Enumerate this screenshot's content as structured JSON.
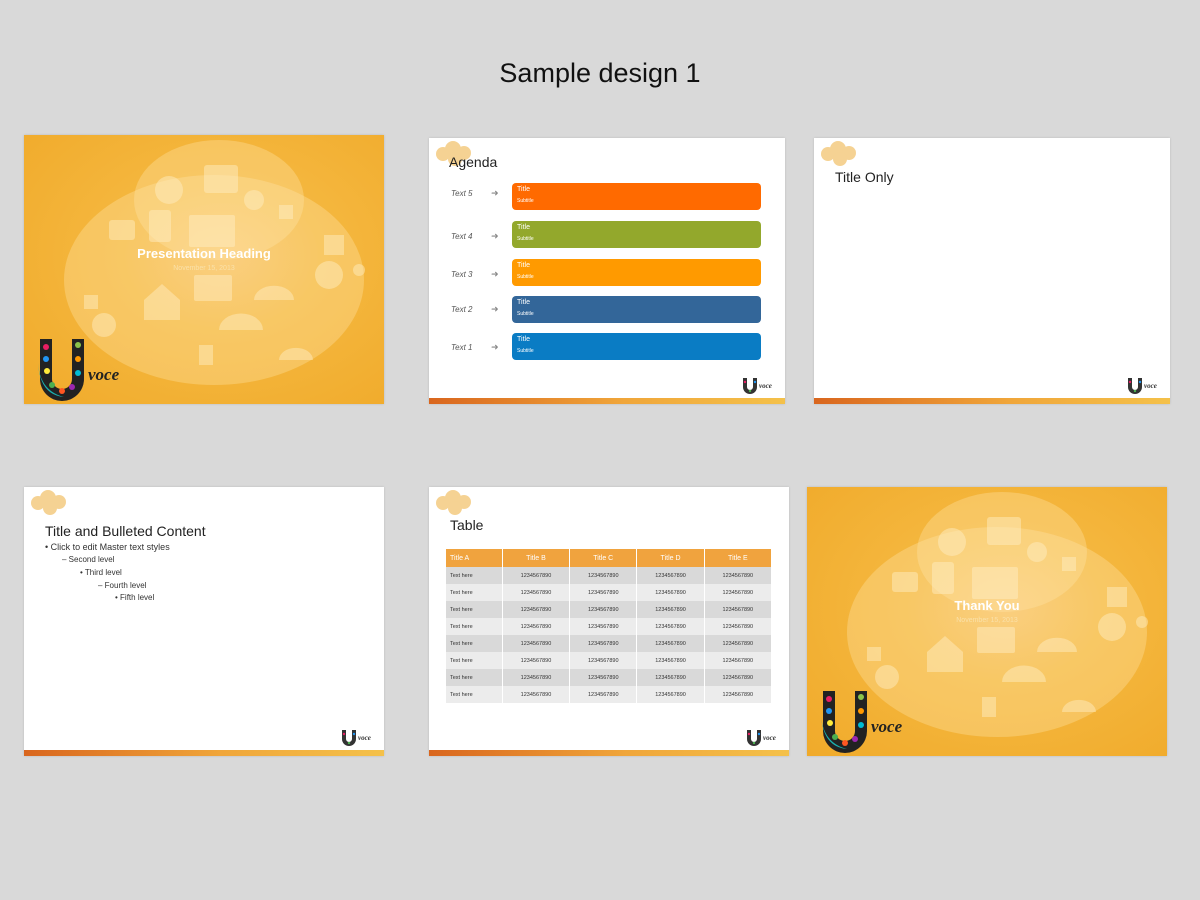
{
  "page_title": "Sample design 1",
  "slides": {
    "title_slide": {
      "heading": "Presentation Heading",
      "date": "November 15, 2013",
      "logo_text": "voce"
    },
    "agenda": {
      "title": "Agenda",
      "items": [
        {
          "label": "Text 5",
          "title": "Title",
          "subtitle": "Subtitle",
          "color": "#ff6a00"
        },
        {
          "label": "Text 4",
          "title": "Title",
          "subtitle": "Subtitle",
          "color": "#93a82c"
        },
        {
          "label": "Text 3",
          "title": "Title",
          "subtitle": "Subtitle",
          "color": "#ff9a00"
        },
        {
          "label": "Text 2",
          "title": "Title",
          "subtitle": "Subtitle",
          "color": "#336699"
        },
        {
          "label": "Text 1",
          "title": "Title",
          "subtitle": "Subtitle",
          "color": "#0a7cc4"
        }
      ]
    },
    "title_only": {
      "title": "Title Only"
    },
    "bulleted": {
      "title": "Title and Bulleted Content",
      "levels": [
        "Click to edit Master text styles",
        "Second level",
        "Third level",
        "Fourth level",
        "Fifth level"
      ]
    },
    "table": {
      "title": "Table",
      "headers": [
        "Title A",
        "Title B",
        "Title C",
        "Title D",
        "Title E"
      ],
      "rows": [
        [
          "Text here",
          "1234567890",
          "1234567890",
          "1234567890",
          "1234567890"
        ],
        [
          "Text here",
          "1234567890",
          "1234567890",
          "1234567890",
          "1234567890"
        ],
        [
          "Text here",
          "1234567890",
          "1234567890",
          "1234567890",
          "1234567890"
        ],
        [
          "Text here",
          "1234567890",
          "1234567890",
          "1234567890",
          "1234567890"
        ],
        [
          "Text here",
          "1234567890",
          "1234567890",
          "1234567890",
          "1234567890"
        ],
        [
          "Text here",
          "1234567890",
          "1234567890",
          "1234567890",
          "1234567890"
        ],
        [
          "Text here",
          "1234567890",
          "1234567890",
          "1234567890",
          "1234567890"
        ],
        [
          "Text here",
          "1234567890",
          "1234567890",
          "1234567890",
          "1234567890"
        ]
      ]
    },
    "closing": {
      "heading": "Thank You",
      "date": "November 15, 2013",
      "logo_text": "voce"
    }
  },
  "colors": {
    "orange_bg": "#f5b840",
    "bar_start": "#d9661e",
    "bar_end": "#f4c14a",
    "table_header": "#f0a33e"
  }
}
